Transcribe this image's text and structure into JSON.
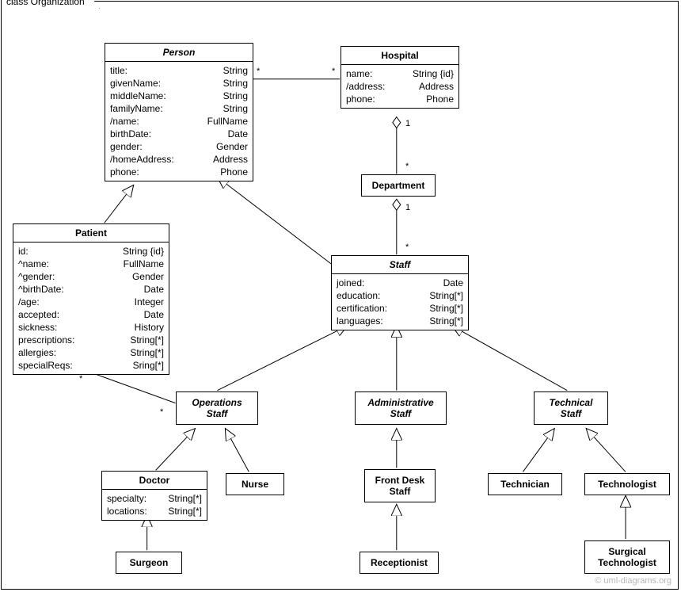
{
  "frame_label": "class Organization",
  "watermark": "© uml-diagrams.org",
  "classes": {
    "person": {
      "name": "Person",
      "attrs": [
        {
          "k": "title:",
          "t": "String"
        },
        {
          "k": "givenName:",
          "t": "String"
        },
        {
          "k": "middleName:",
          "t": "String"
        },
        {
          "k": "familyName:",
          "t": "String"
        },
        {
          "k": "/name:",
          "t": "FullName"
        },
        {
          "k": "birthDate:",
          "t": "Date"
        },
        {
          "k": "gender:",
          "t": "Gender"
        },
        {
          "k": "/homeAddress:",
          "t": "Address"
        },
        {
          "k": "phone:",
          "t": "Phone"
        }
      ]
    },
    "hospital": {
      "name": "Hospital",
      "attrs": [
        {
          "k": "name:",
          "t": "String {id}"
        },
        {
          "k": "/address:",
          "t": "Address"
        },
        {
          "k": "phone:",
          "t": "Phone"
        }
      ]
    },
    "department": {
      "name": "Department"
    },
    "patient": {
      "name": "Patient",
      "attrs": [
        {
          "k": "id:",
          "t": "String {id}"
        },
        {
          "k": "^name:",
          "t": "FullName"
        },
        {
          "k": "^gender:",
          "t": "Gender"
        },
        {
          "k": "^birthDate:",
          "t": "Date"
        },
        {
          "k": "/age:",
          "t": "Integer"
        },
        {
          "k": "accepted:",
          "t": "Date"
        },
        {
          "k": "sickness:",
          "t": "History"
        },
        {
          "k": "prescriptions:",
          "t": "String[*]"
        },
        {
          "k": "allergies:",
          "t": "String[*]"
        },
        {
          "k": "specialReqs:",
          "t": "Sring[*]"
        }
      ]
    },
    "staff": {
      "name": "Staff",
      "attrs": [
        {
          "k": "joined:",
          "t": "Date"
        },
        {
          "k": "education:",
          "t": "String[*]"
        },
        {
          "k": "certification:",
          "t": "String[*]"
        },
        {
          "k": "languages:",
          "t": "String[*]"
        }
      ]
    },
    "opstaff": {
      "name": "Operations",
      "sub": "Staff"
    },
    "adminstaff": {
      "name": "Administrative",
      "sub": "Staff"
    },
    "techstaff": {
      "name": "Technical",
      "sub": "Staff"
    },
    "doctor": {
      "name": "Doctor",
      "attrs": [
        {
          "k": "specialty:",
          "t": "String[*]"
        },
        {
          "k": "locations:",
          "t": "String[*]"
        }
      ]
    },
    "nurse": {
      "name": "Nurse"
    },
    "frontdesk": {
      "name": "Front Desk",
      "sub": "Staff"
    },
    "technician": {
      "name": "Technician"
    },
    "technologist": {
      "name": "Technologist"
    },
    "surgeon": {
      "name": "Surgeon"
    },
    "receptionist": {
      "name": "Receptionist"
    },
    "surgtech": {
      "name": "Surgical",
      "sub": "Technologist"
    }
  },
  "mult": {
    "star": "*",
    "one": "1"
  }
}
